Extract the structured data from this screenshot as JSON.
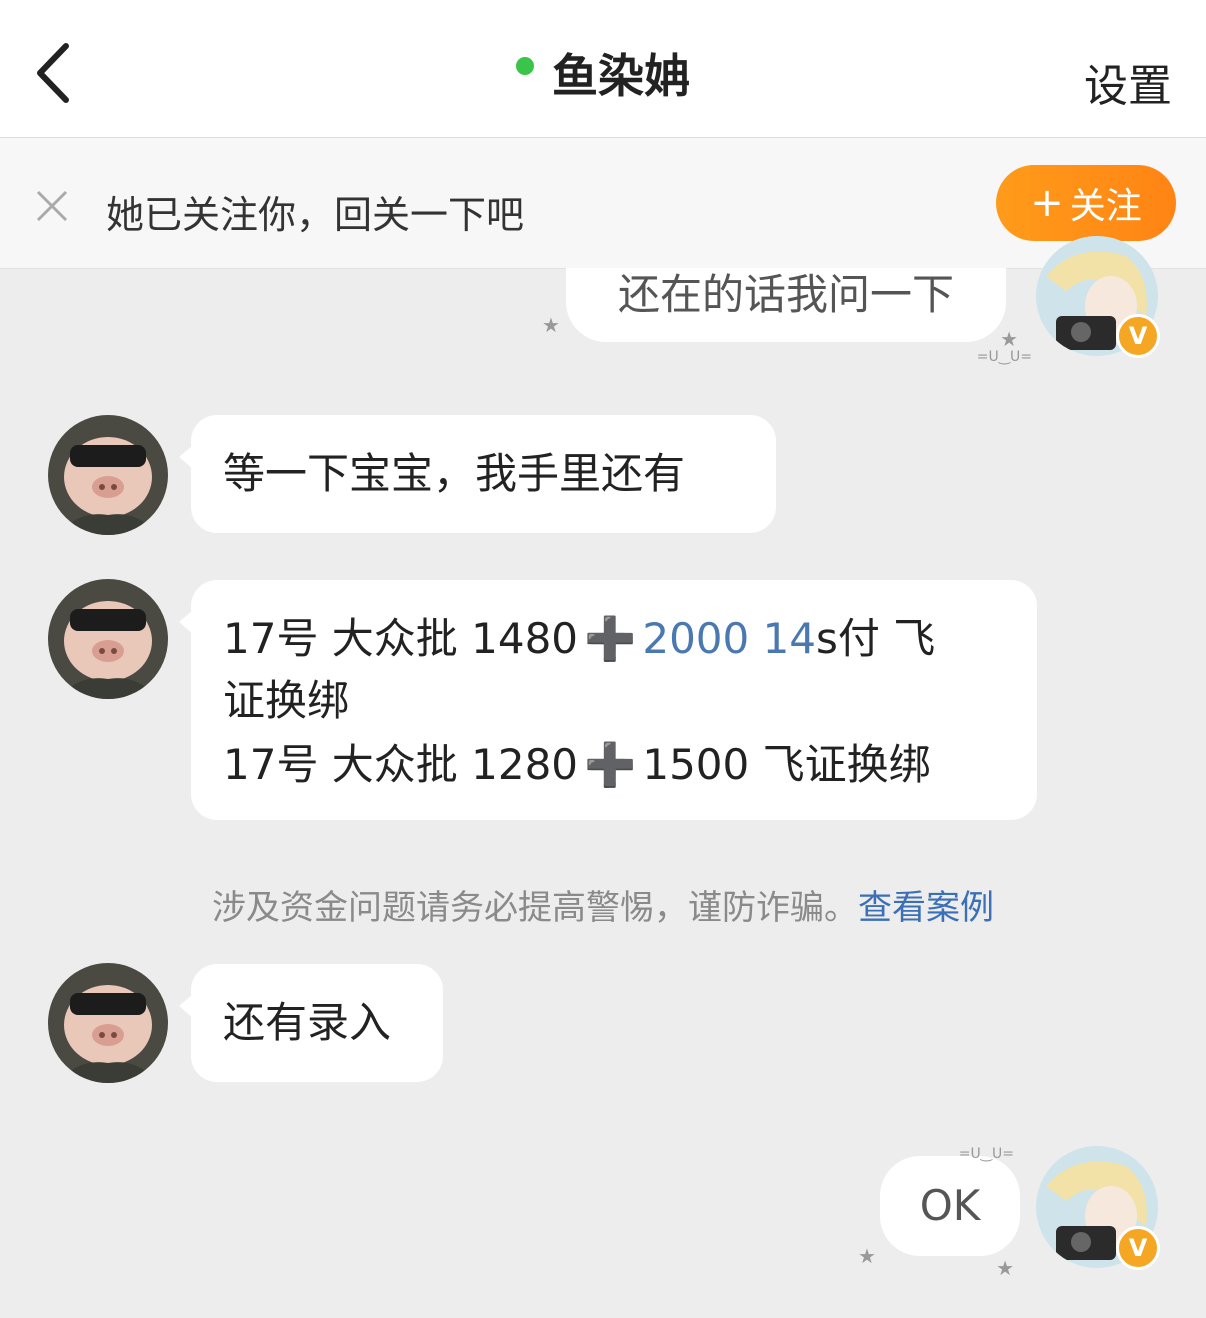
{
  "header": {
    "title": "鱼染姌",
    "settings_label": "设置",
    "back_icon": "chevron-left-icon",
    "online_color": "#3bc44a"
  },
  "follow_banner": {
    "text": "她已关注你，回关一下吧",
    "button_label": "关注",
    "button_plus": "+",
    "button_color": "#ff8c17"
  },
  "messages": [
    {
      "side": "right",
      "text": "还在的话我问一下"
    },
    {
      "side": "left",
      "text": "等一下宝宝，我手里还有"
    },
    {
      "side": "left",
      "line1_a": "17号 大众批 1480",
      "line1_plus": "➕",
      "line1_link": "2000 14",
      "line1_b": "s付 飞",
      "line2": "证换绑",
      "line3_a": "17号 大众批 1280",
      "line3_plus": "➕",
      "line3_b": "1500 飞证换绑"
    },
    {
      "side": "left",
      "text": "还有录入"
    },
    {
      "side": "right",
      "text": "OK"
    }
  ],
  "warning": {
    "text": "涉及资金问题请务必提高警惕，谨防诈骗。",
    "link": "查看案例"
  },
  "badge_letter": "V",
  "deco_face": "=U‿U="
}
